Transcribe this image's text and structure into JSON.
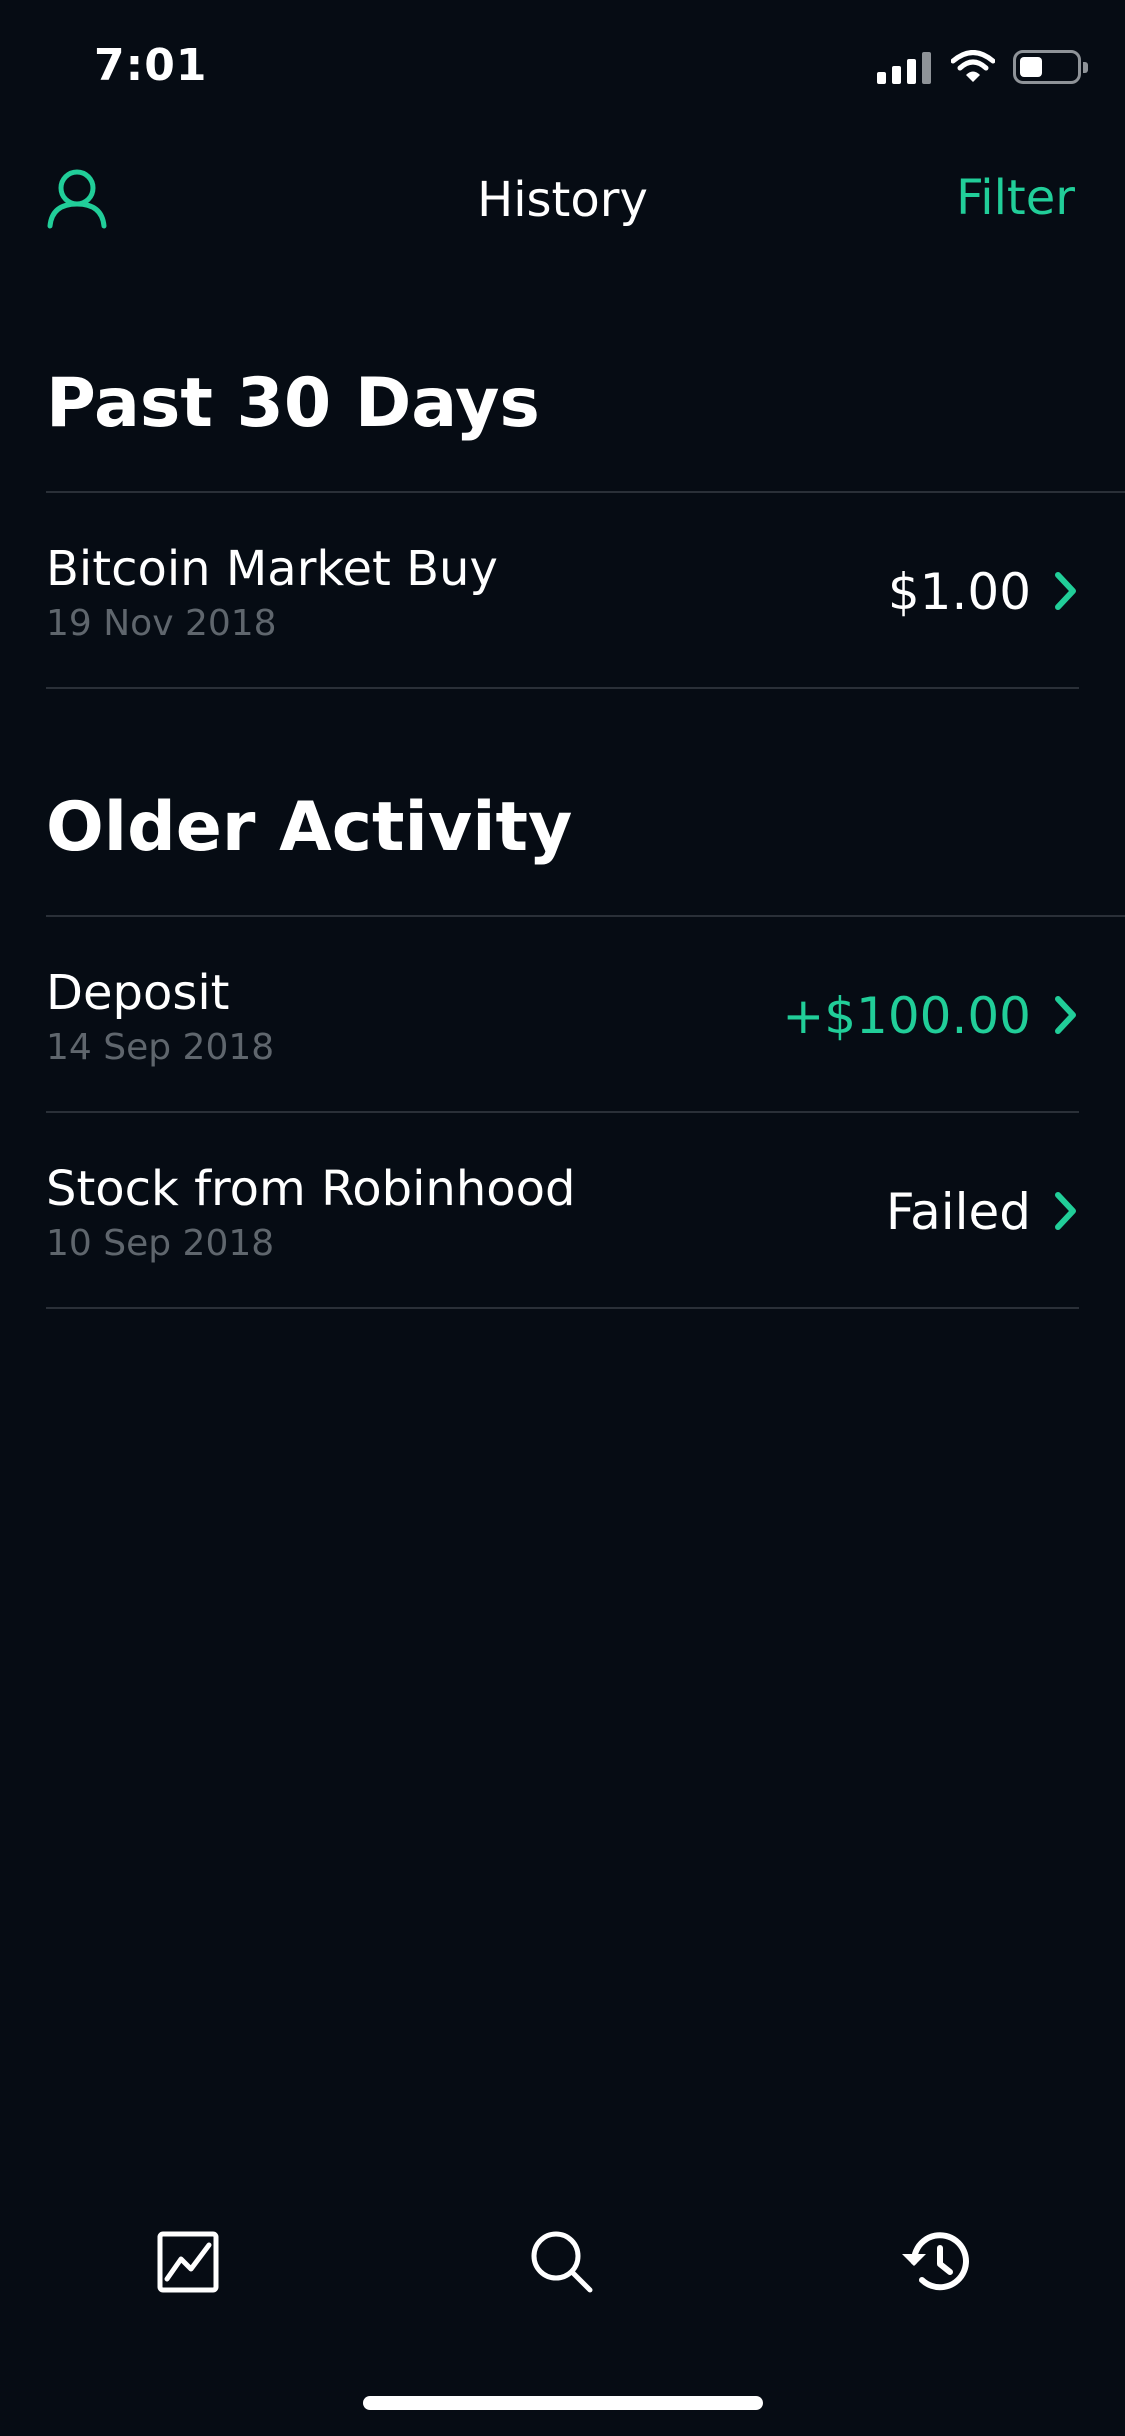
{
  "status_bar": {
    "time": "7:01"
  },
  "header": {
    "title": "History",
    "filter_label": "Filter",
    "accent_color": "#21ce99"
  },
  "sections": [
    {
      "title": "Past 30 Days",
      "items": [
        {
          "title": "Bitcoin Market Buy",
          "date": "19 Nov 2018",
          "value": "$1.00"
        }
      ]
    },
    {
      "title": "Older Activity",
      "items": [
        {
          "title": "Deposit",
          "date": "14 Sep 2018",
          "value": "+$100.00"
        },
        {
          "title": "Stock from Robinhood",
          "date": "10 Sep 2018",
          "value": "Failed"
        }
      ]
    }
  ],
  "tab_bar": {
    "tabs": [
      {
        "icon": "chart-icon"
      },
      {
        "icon": "search-icon"
      },
      {
        "icon": "history-icon"
      }
    ]
  }
}
